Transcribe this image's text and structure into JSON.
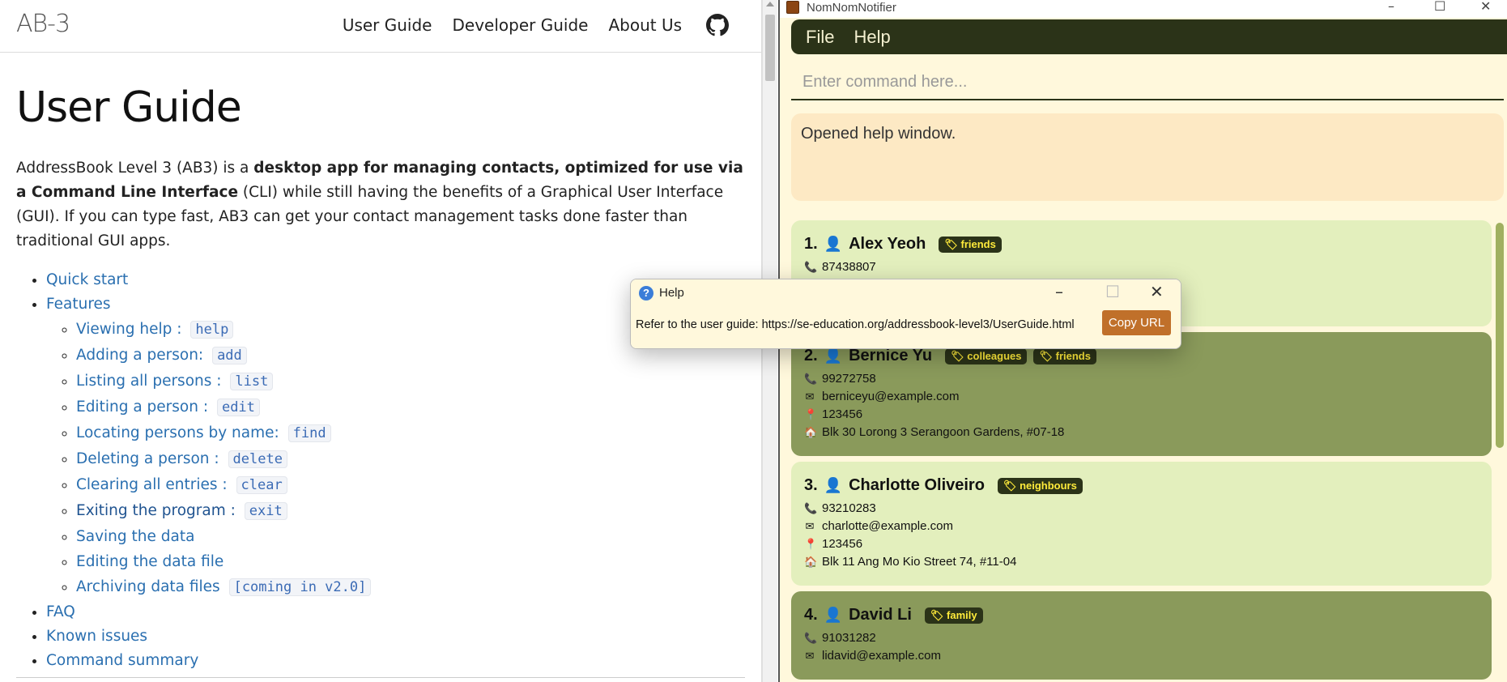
{
  "browser": {
    "brand": "AB-3",
    "nav": [
      "User Guide",
      "Developer Guide",
      "About Us"
    ],
    "page_title": "User Guide",
    "intro": {
      "p1": "AddressBook Level 3 (AB3) is a ",
      "b1": "desktop app for managing contacts, optimized for use via a Command Line Interface",
      "p2": " (CLI) while still having the benefits of a Graphical User Interface (GUI). If you can type fast, AB3 can get your contact management tasks done faster than traditional GUI apps."
    },
    "toc": {
      "quick_start": "Quick start",
      "features": "Features",
      "sub": [
        {
          "label": "Viewing help : ",
          "code": "help"
        },
        {
          "label": "Adding a person: ",
          "code": "add"
        },
        {
          "label": "Listing all persons : ",
          "code": "list"
        },
        {
          "label": "Editing a person : ",
          "code": "edit"
        },
        {
          "label": "Locating persons by name: ",
          "code": "find"
        },
        {
          "label": "Deleting a person : ",
          "code": "delete"
        },
        {
          "label": "Clearing all entries : ",
          "code": "clear"
        },
        {
          "label": "Exiting the program : ",
          "code": "exit"
        },
        {
          "label": "Saving the data",
          "code": ""
        },
        {
          "label": "Editing the data file",
          "code": ""
        },
        {
          "label": "Archiving data files ",
          "code": "[coming in v2.0]"
        }
      ],
      "faq": "FAQ",
      "known_issues": "Known issues",
      "command_summary": "Command summary"
    }
  },
  "app": {
    "title": "NomNomNotifier",
    "menu": [
      "File",
      "Help"
    ],
    "command_placeholder": "Enter command here...",
    "result": "Opened help window.",
    "persons": [
      {
        "index": "1.",
        "name": "Alex Yeoh",
        "tags": [
          "friends"
        ],
        "phone": "87438807",
        "email": "",
        "postal": "",
        "address": "",
        "style": "light"
      },
      {
        "index": "2.",
        "name": "Bernice Yu",
        "tags": [
          "colleagues",
          "friends"
        ],
        "phone": "99272758",
        "email": "berniceyu@example.com",
        "postal": "123456",
        "address": "Blk 30 Lorong 3 Serangoon Gardens, #07-18",
        "style": "dark"
      },
      {
        "index": "3.",
        "name": "Charlotte Oliveiro",
        "tags": [
          "neighbours"
        ],
        "phone": "93210283",
        "email": "charlotte@example.com",
        "postal": "123456",
        "address": "Blk 11 Ang Mo Kio Street 74, #11-04",
        "style": "light"
      },
      {
        "index": "4.",
        "name": "David Li",
        "tags": [
          "family"
        ],
        "phone": "91031282",
        "email": "lidavid@example.com",
        "postal": "",
        "address": "",
        "style": "dark"
      }
    ]
  },
  "help_dialog": {
    "title": "Help",
    "text": "Refer to the user guide: https://se-education.org/addressbook-level3/UserGuide.html",
    "copy_label": "Copy URL"
  },
  "icons": {
    "github": "github-icon",
    "person": "person-icon",
    "phone": "phone-icon",
    "email": "email-icon",
    "postal": "pin-icon",
    "address": "home-icon",
    "tag": "tag-icon"
  }
}
